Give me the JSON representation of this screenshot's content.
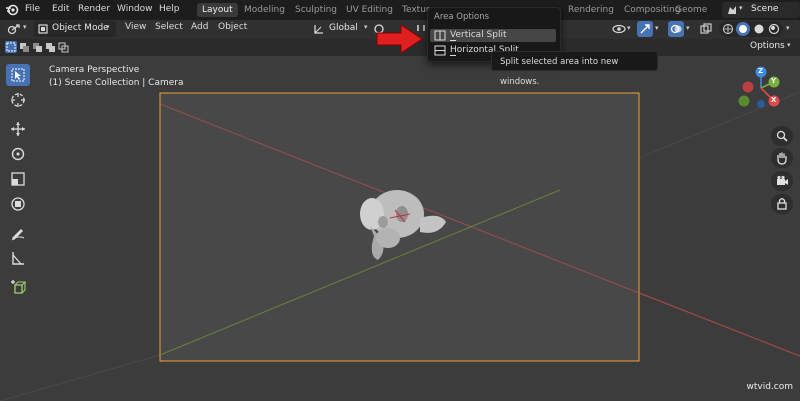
{
  "topbar": {
    "menus": [
      "File",
      "Edit",
      "Render",
      "Window",
      "Help"
    ],
    "workspace_tabs": [
      "Layout",
      "Modeling",
      "Sculpting",
      "UV Editing",
      "Textur",
      "Rendering",
      "Compositing",
      "Geome"
    ],
    "active_tab": "Layout",
    "scene_label": "Scene"
  },
  "header": {
    "mode": "Object Mode",
    "view": "View",
    "select": "Select",
    "add": "Add",
    "object": "Object",
    "transform_orientation": "Global",
    "options": "Options"
  },
  "viewport": {
    "camera_label": "Camera Perspective",
    "collection_label": "(1) Scene Collection | Camera",
    "gizmo_axes": {
      "z": "Z",
      "y": "Y",
      "x": "X"
    }
  },
  "area_options_menu": {
    "title": "Area Options",
    "items": [
      {
        "label": "Vertical Split",
        "underline_char": "V"
      },
      {
        "label": "Horizontal Split",
        "underline_char": "H"
      }
    ],
    "tooltip": "Split selected area into new windows."
  },
  "watermark": "wtvid.com",
  "colors": {
    "accent": "#4772b3",
    "camera_frame": "#e8a23a",
    "x_axis": "#e04a4a",
    "y_axis": "#7ab040",
    "z_axis": "#3c8be0",
    "arrow": "#e02020"
  }
}
